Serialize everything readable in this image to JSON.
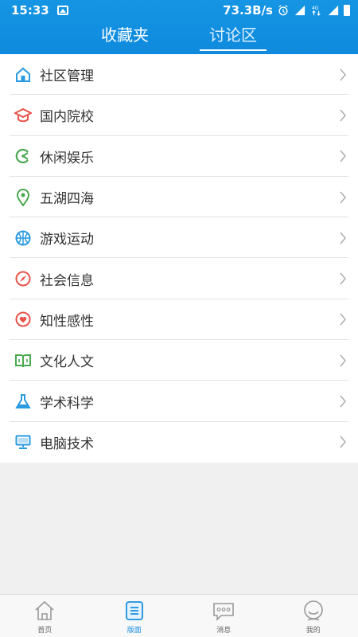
{
  "status": {
    "time": "15:33",
    "speed": "73.3B/s",
    "net": "4G"
  },
  "tabs": [
    {
      "label": "收藏夹",
      "active": false
    },
    {
      "label": "讨论区",
      "active": true
    }
  ],
  "categories": [
    {
      "label": "社区管理",
      "icon": "home-icon",
      "color": "#2a9be0"
    },
    {
      "label": "国内院校",
      "icon": "graduation-cap-icon",
      "color": "#e8534a"
    },
    {
      "label": "休闲娱乐",
      "icon": "pacman-icon",
      "color": "#4aa84f"
    },
    {
      "label": "五湖四海",
      "icon": "location-pin-icon",
      "color": "#4aa84f"
    },
    {
      "label": "游戏运动",
      "icon": "basketball-icon",
      "color": "#2a9be0"
    },
    {
      "label": "社会信息",
      "icon": "compass-icon",
      "color": "#e8534a"
    },
    {
      "label": "知性感性",
      "icon": "heart-circle-icon",
      "color": "#e8534a"
    },
    {
      "label": "文化人文",
      "icon": "book-icon",
      "color": "#4aa84f"
    },
    {
      "label": "学术科学",
      "icon": "flask-icon",
      "color": "#2a9be0"
    },
    {
      "label": "电脑技术",
      "icon": "monitor-icon",
      "color": "#2a9be0"
    }
  ],
  "bottom_nav": [
    {
      "label": "首页",
      "icon": "home-nav-icon",
      "active": false
    },
    {
      "label": "版面",
      "icon": "board-nav-icon",
      "active": true
    },
    {
      "label": "消息",
      "icon": "message-nav-icon",
      "active": false
    },
    {
      "label": "我的",
      "icon": "profile-nav-icon",
      "active": false
    }
  ]
}
